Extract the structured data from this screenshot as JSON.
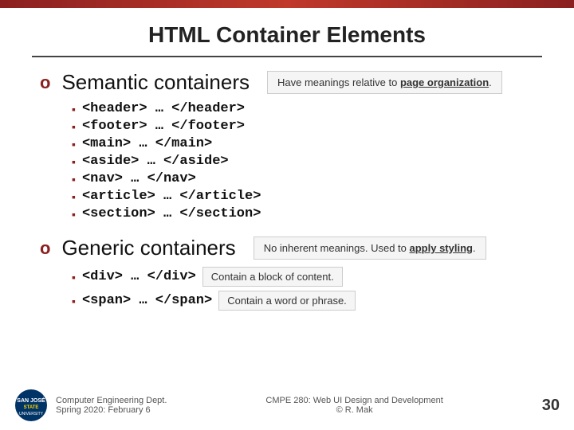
{
  "page": {
    "topbar_color": "#8b2020",
    "title": "HTML Container Elements"
  },
  "section1": {
    "bullet": "o",
    "title": "Semantic containers",
    "info_box": {
      "text_before": "Have meanings relative to ",
      "highlight": "page organization",
      "text_after": "."
    },
    "items": [
      "<header> … </header>",
      "<footer> … </footer>",
      "<main> … </main>",
      "<aside> … </aside>",
      "<nav> … </nav>",
      "<article> … </article>",
      "<section> … </section>"
    ]
  },
  "section2": {
    "bullet": "o",
    "title": "Generic containers",
    "no_meanings_box": {
      "text_before": "No inherent meanings. Used to ",
      "highlight": "apply styling",
      "text_after": "."
    },
    "items": [
      {
        "code": "<div> … </div>",
        "desc": "Contain a block of content."
      },
      {
        "code": "<span> … </span>",
        "desc": "Contain a word or phrase."
      }
    ]
  },
  "footer": {
    "dept": "Computer Engineering Dept.",
    "semester": "Spring 2020: February 6",
    "course": "CMPE 280: Web UI Design and Development",
    "instructor": "© R. Mak",
    "page_number": "30"
  }
}
